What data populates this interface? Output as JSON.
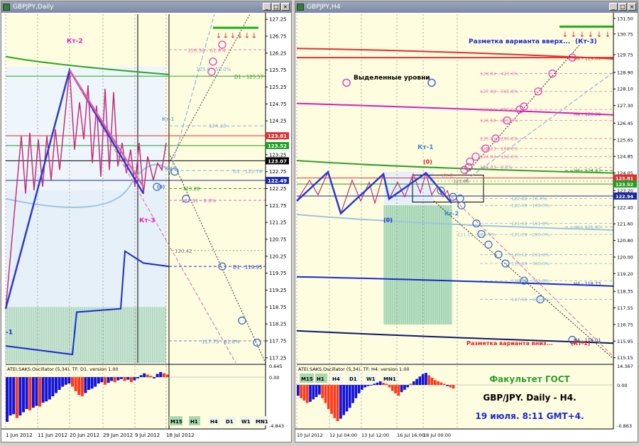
{
  "windows": [
    {
      "title": "GBPJPY,Daily"
    },
    {
      "title": "GBPJPY,H4"
    }
  ],
  "indicator_label_left": "ATEI.SAKS.Oscillator (5,34). TF: D1. version 1.00",
  "indicator_label_right": "ATEI.SAKS.Oscillator (5,34). TF: H4. version 1.00",
  "timeframes_left": [
    "M15",
    "H1",
    "H4",
    "D1",
    "W1",
    "MN1"
  ],
  "timeframes_right": [
    "M15",
    "H1",
    "H4",
    "D1",
    "W1",
    "MN1"
  ],
  "caption": {
    "line1": "Факультет ГОСТ",
    "line2": "GBP/JPY. Daily - H4.",
    "line3": "19 июля. 8:11 GMT+4."
  },
  "colors": {
    "bg": "#fffde0",
    "bull_hist": "#1414d8",
    "bear_hist": "#ff3a1a",
    "grid": "#9a9a9a"
  },
  "chart_data": [
    {
      "type": "line",
      "title": "GBPJPY,Daily",
      "x_ticks": [
        "1 Jun 2012",
        "11 Jun 2012",
        "20 Jun 2012",
        "29 Jun 2012",
        "9 Jul 2012",
        "18 Jul 2012"
      ],
      "y_ticks": [
        "127.25",
        "126.75",
        "126.25",
        "125.75",
        "125.25",
        "124.75",
        "124.25",
        "123.75",
        "123.25",
        "122.75",
        "122.25",
        "121.75",
        "121.25",
        "120.75",
        "120.25",
        "119.75",
        "119.25",
        "118.75",
        "118.25",
        "117.75",
        "117.25"
      ],
      "ylim": [
        117.1,
        127.4
      ],
      "price_tags": [
        {
          "v": "123.81",
          "c": "#e03030"
        },
        {
          "v": "123.52",
          "c": "#20a020"
        },
        {
          "v": "123.07",
          "c": "#000000"
        },
        {
          "v": "122.49",
          "c": "#1a2aa0"
        }
      ],
      "level_labels": [
        "126.38 - 61.8%",
        "125.8 - 50.0%",
        "D1 - 125.57",
        "124.13",
        "D1 - 122.78",
        "123.28",
        "121.91 - 0.0%",
        "120.42",
        "D1 - 119.95",
        "117.75 - 61.8%"
      ],
      "annotations": [
        "Кт-2",
        "Кт-3",
        "Кт-1",
        "Кт-3",
        "(0)",
        "-1"
      ],
      "osc_scale": [
        "0.645",
        "0.00",
        "-4.843"
      ]
    },
    {
      "type": "line",
      "title": "GBPJPY,H4",
      "x_ticks": [
        "10 Jul 2012",
        "12 Jul 04:00",
        "13 Jul 12:00",
        "16 Jul 16:00",
        "18 Jul 00:00"
      ],
      "y_ticks": [
        "131.50",
        "130.75",
        "129.75",
        "128.90",
        "128.10",
        "127.30",
        "126.45",
        "125.65",
        "124.85",
        "124.05",
        "123.20",
        "122.40",
        "121.60",
        "120.80",
        "120.00",
        "119.20",
        "118.35",
        "117.55",
        "116.75",
        "115.95",
        "115.15"
      ],
      "ylim": [
        114.9,
        131.7
      ],
      "price_tags": [
        {
          "v": "123.81",
          "c": "#e03030"
        },
        {
          "v": "123.52",
          "c": "#20a020"
        },
        {
          "v": "122.94",
          "c": "#1a2aa0"
        }
      ],
      "level_labels": [
        "H4 - 129.61",
        "128.84 - 423.6%",
        "127.98 - 361.8%",
        "127.11 - 300.0%",
        "126.58 - 261.8%",
        "125.71 - 200.0%",
        "125.23 - 161.8%",
        "124.84 - 100.0%",
        "124.33 - 0.0%",
        "H4 - 126.89",
        "H4 - 124.17",
        "123.66",
        "122.82 - 76.4%",
        "122.49 - 100.0%",
        "121.62 - 161.8%",
        "121.11 - 261.8%",
        "121.09 - 200.0%",
        "120.12 - 261.8%",
        "119.69 - 300.0%",
        "118.86 - 361.8%",
        "117.96 - 423.6%",
        "H4 - 121.45",
        "H4 - 118.73",
        "H4 - 116.01"
      ],
      "annotations": [
        "Разметка варианта вверх...",
        "(Кт-3)",
        "Выделенные уровни",
        "Кт-1",
        "(0)",
        "Кт-2",
        "(0)",
        "Кт-2",
        "Разметка варианта вниз...",
        "(Кт-1)"
      ],
      "osc_scale": [
        "14.367",
        "0.00",
        "-0.863"
      ]
    }
  ]
}
